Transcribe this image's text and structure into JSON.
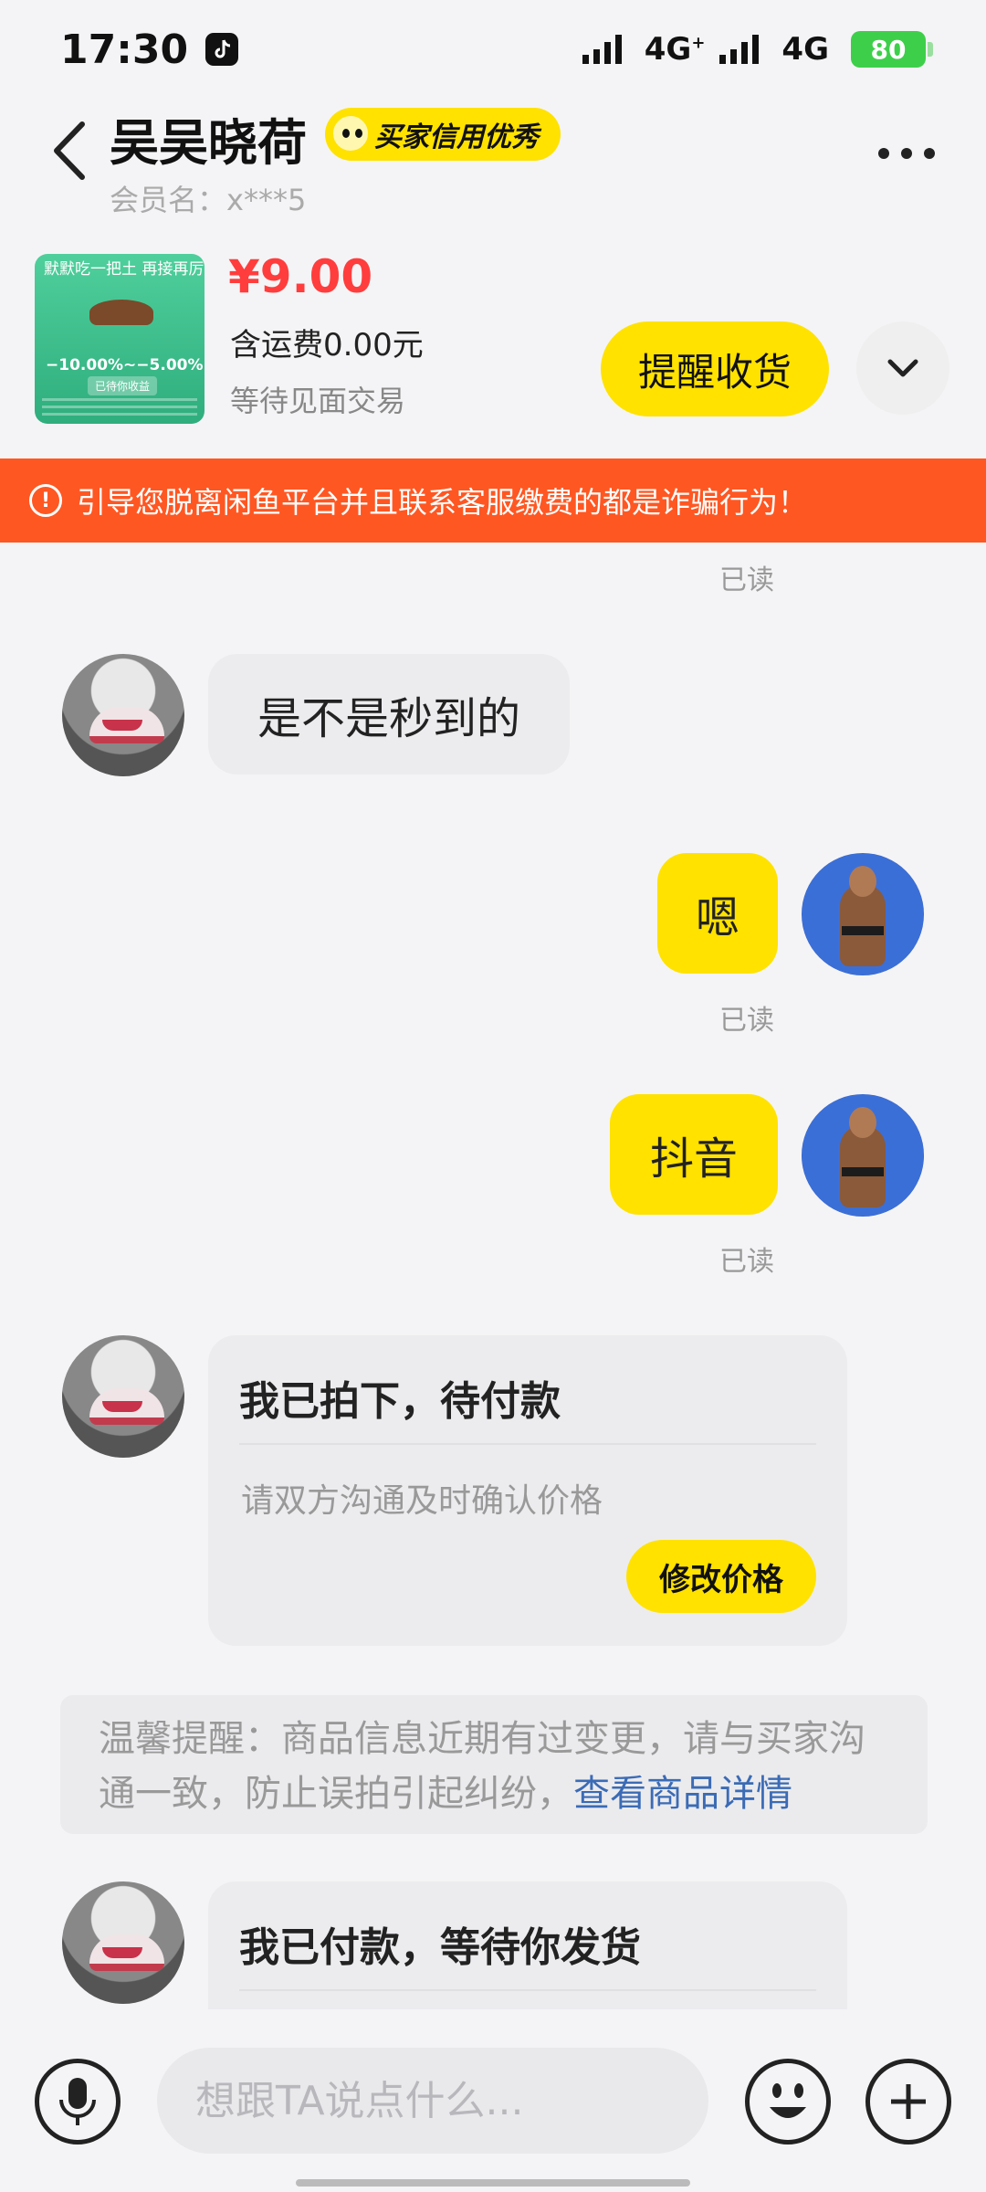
{
  "status_bar": {
    "time": "17:30",
    "net1": "4G",
    "net1_sup": "+",
    "net2": "4G",
    "battery": "80"
  },
  "header": {
    "contact_name": "吴吴晓荷",
    "credit_badge": "买家信用优秀",
    "member_label": "会员名：x***5"
  },
  "product": {
    "thumb_line1": "默默吃一把土 再接再厉",
    "thumb_percent": "−10.00%~−5.00%",
    "thumb_chip": "已待你收益",
    "price": "¥9.00",
    "shipping": "含运费0.00元",
    "trade_status": "等待见面交易",
    "remind_button": "提醒收货"
  },
  "warning": {
    "text": "引导您脱离闲鱼平台并且联系客服缴费的都是诈骗行为！"
  },
  "chat": {
    "read_label": "已读",
    "msg1": "是不是秒到的",
    "msg2": "嗯",
    "msg3": "抖音",
    "order1_title": "我已拍下，待付款",
    "order1_sub": "请双方沟通及时确认价格",
    "order1_button": "修改价格",
    "tip_text": "温馨提醒：商品信息近期有过变更，请与买家沟通一致，防止误拍引起纠纷，",
    "tip_link": "查看商品详情",
    "order2_title": "我已付款，等待你发货"
  },
  "input": {
    "placeholder": "想跟TA说点什么..."
  },
  "colors": {
    "accent_yellow": "#ffe200",
    "warning_orange": "#ff5722",
    "price_red": "#ff3d3d",
    "link_blue": "#3b6bb5"
  }
}
